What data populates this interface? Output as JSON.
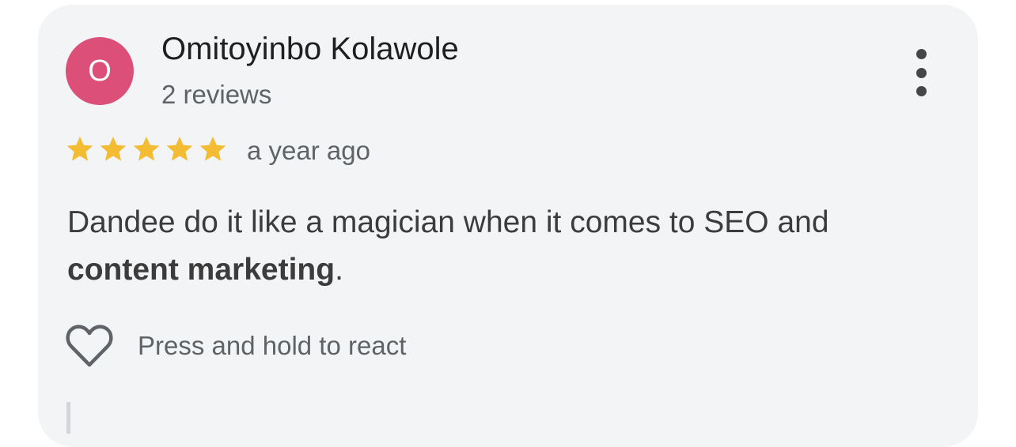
{
  "review": {
    "avatar_letter": "O",
    "avatar_color": "#dc4f78",
    "reviewer_name": "Omitoyinbo Kolawole",
    "reviewer_reviews": "2 reviews",
    "rating": 5,
    "rating_max": 5,
    "star_color": "#f4bc33",
    "time_ago": "a year ago",
    "text_part1": "Dandee do it like a magician when it comes to SEO and ",
    "text_bold": "content marketing",
    "text_part2": ".",
    "react_label": "Press and hold to react",
    "icons": {
      "more": "more-vert-icon",
      "star": "star-icon",
      "react": "heart-icon"
    }
  }
}
